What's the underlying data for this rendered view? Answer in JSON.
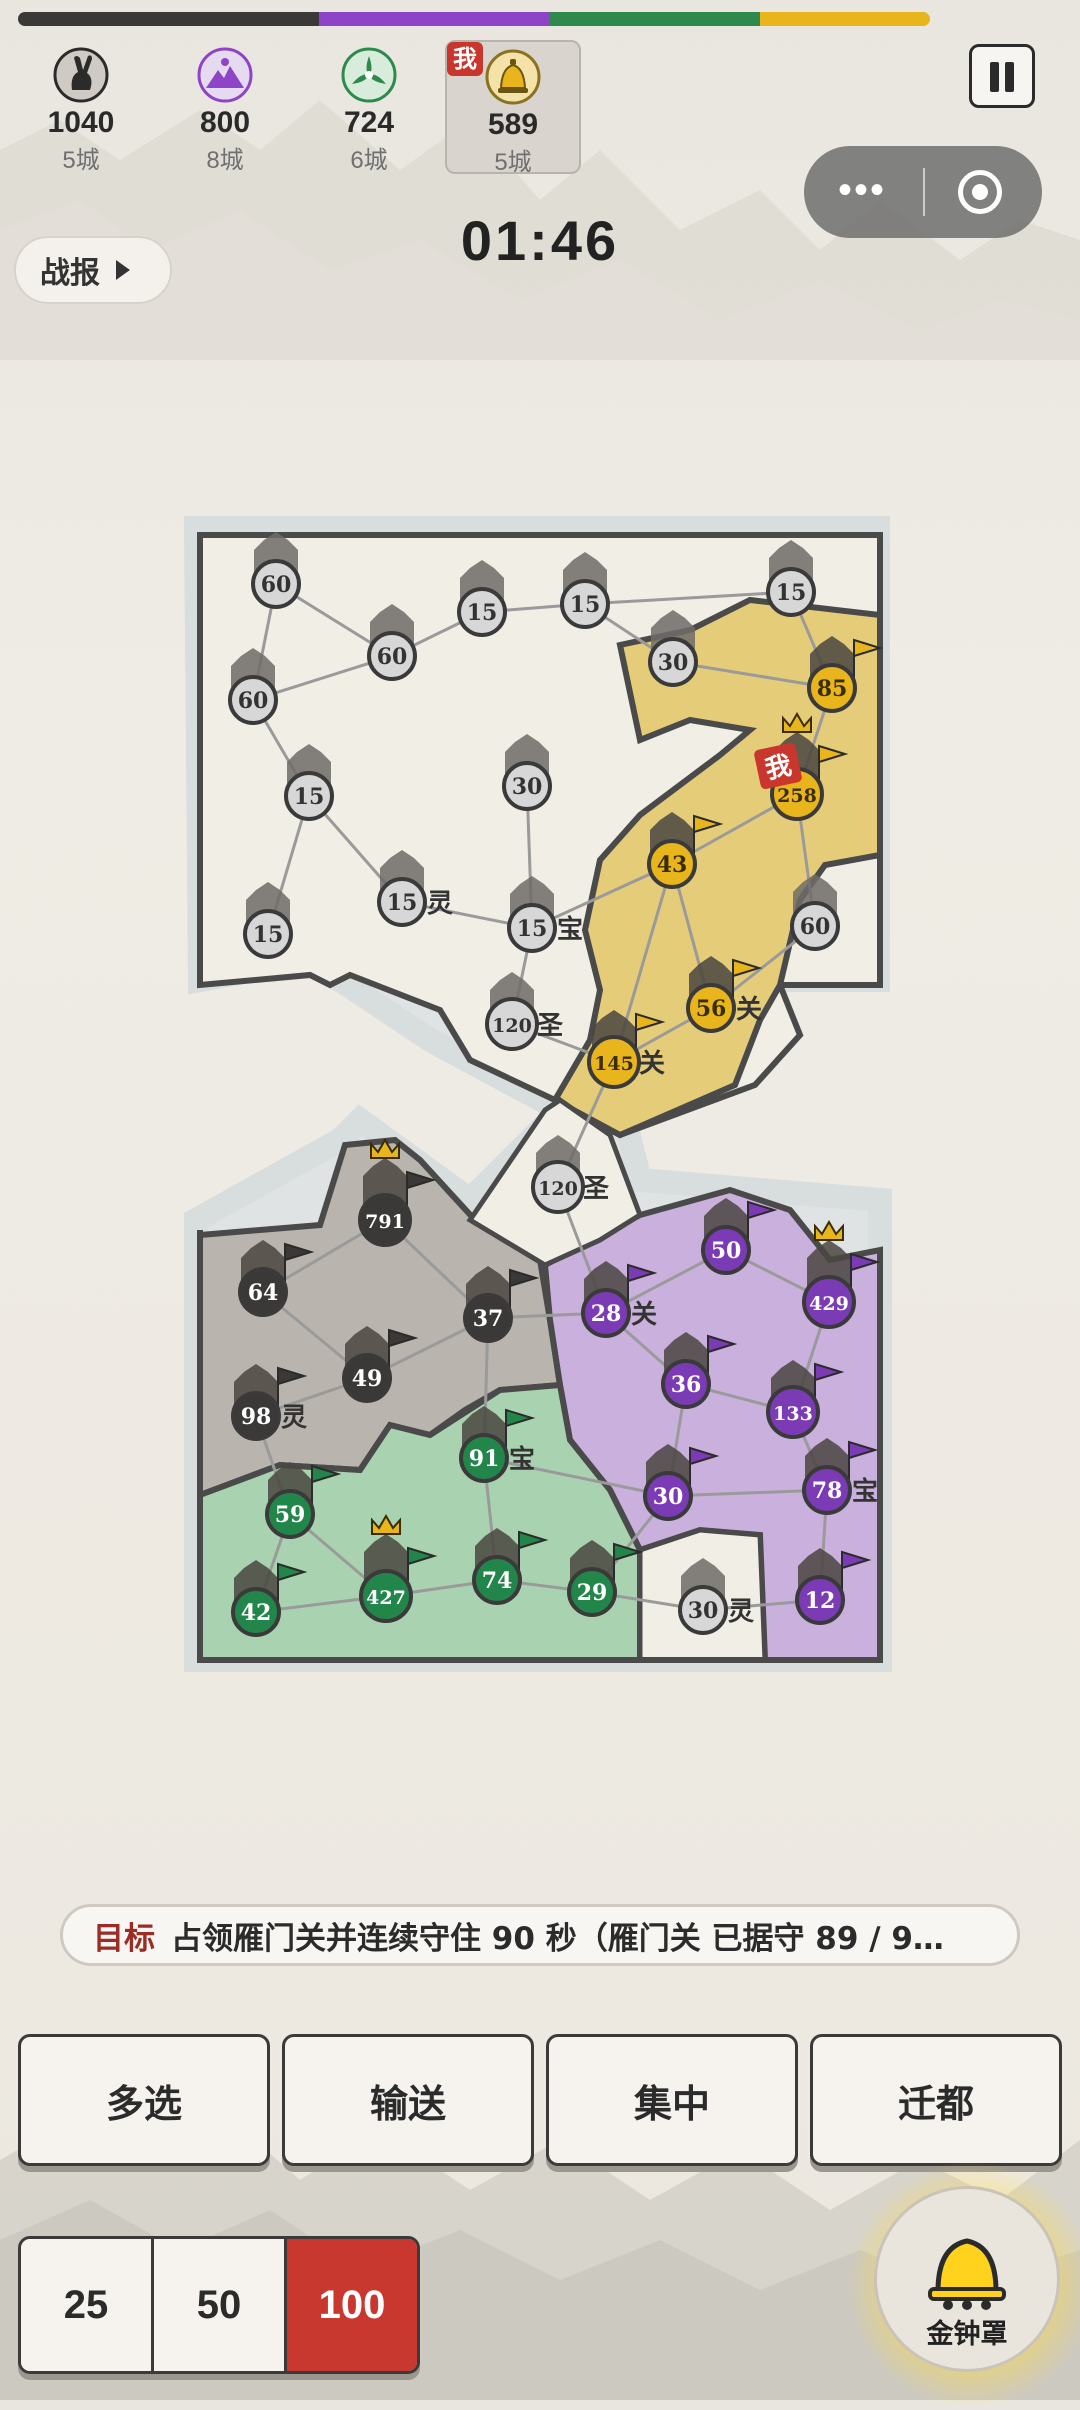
{
  "colors": {
    "dark": "#3a3938",
    "purple": "#8e44c6",
    "green": "#2e8a4c",
    "yellow": "#e8b51c",
    "neutral": "#cfcfcf",
    "gray_region": "#b9b4ad",
    "purple_region": "#c9b0dd",
    "green_region": "#a9d3b0",
    "yellow_region": "#e5cc79",
    "neutral_region": "#f1eee6"
  },
  "power_bar": [
    {
      "faction": "dark",
      "share": 1040
    },
    {
      "faction": "purple",
      "share": 800
    },
    {
      "faction": "green",
      "share": 724
    },
    {
      "faction": "yellow",
      "share": 589
    }
  ],
  "players": [
    {
      "score": "1040",
      "cities": "5城",
      "icon": "rabbit-icon",
      "faction": "dark"
    },
    {
      "score": "800",
      "cities": "8城",
      "icon": "mountain-icon",
      "faction": "purple"
    },
    {
      "score": "724",
      "cities": "6城",
      "icon": "shuriken-icon",
      "faction": "green"
    },
    {
      "score": "589",
      "cities": "5城",
      "icon": "bell-icon",
      "faction": "yellow",
      "me": true,
      "badge": "我"
    }
  ],
  "timer": "01:46",
  "report_button": "战报",
  "capsule": {
    "more": "•••"
  },
  "cities": [
    {
      "id": "c1",
      "value": "60",
      "owner": "neutral"
    },
    {
      "id": "c2",
      "value": "60",
      "owner": "neutral"
    },
    {
      "id": "c3",
      "value": "60",
      "owner": "neutral"
    },
    {
      "id": "c4",
      "value": "15",
      "owner": "neutral"
    },
    {
      "id": "c5",
      "value": "15",
      "owner": "neutral"
    },
    {
      "id": "c6",
      "value": "30",
      "owner": "neutral"
    },
    {
      "id": "c7",
      "value": "15",
      "owner": "neutral"
    },
    {
      "id": "c8",
      "value": "85",
      "owner": "yellow"
    },
    {
      "id": "c9",
      "value": "15",
      "owner": "neutral"
    },
    {
      "id": "c10",
      "value": "30",
      "owner": "neutral"
    },
    {
      "id": "c11",
      "value": "258",
      "owner": "yellow",
      "capital": true,
      "me": true
    },
    {
      "id": "c12",
      "value": "43",
      "owner": "yellow"
    },
    {
      "id": "c13",
      "value": "15",
      "owner": "neutral",
      "tag": "灵"
    },
    {
      "id": "c14",
      "value": "15",
      "owner": "neutral",
      "tag": "宝"
    },
    {
      "id": "c15",
      "value": "15",
      "owner": "neutral"
    },
    {
      "id": "c16",
      "value": "60",
      "owner": "neutral"
    },
    {
      "id": "c17",
      "value": "56",
      "owner": "yellow",
      "tag": "关"
    },
    {
      "id": "c18",
      "value": "120",
      "owner": "neutral",
      "tag": "圣"
    },
    {
      "id": "c19",
      "value": "145",
      "owner": "yellow",
      "tag": "关"
    },
    {
      "id": "c20",
      "value": "120",
      "owner": "neutral",
      "tag": "圣"
    },
    {
      "id": "c21",
      "value": "791",
      "owner": "dark",
      "capital": true
    },
    {
      "id": "c22",
      "value": "64",
      "owner": "dark"
    },
    {
      "id": "c23",
      "value": "37",
      "owner": "dark"
    },
    {
      "id": "c24",
      "value": "49",
      "owner": "dark"
    },
    {
      "id": "c25",
      "value": "98",
      "owner": "dark",
      "tag": "灵"
    },
    {
      "id": "c26",
      "value": "50",
      "owner": "purple"
    },
    {
      "id": "c27",
      "value": "429",
      "owner": "purple",
      "capital": true
    },
    {
      "id": "c28",
      "value": "28",
      "owner": "purple",
      "tag": "关"
    },
    {
      "id": "c29",
      "value": "36",
      "owner": "purple"
    },
    {
      "id": "c30",
      "value": "133",
      "owner": "purple"
    },
    {
      "id": "c31",
      "value": "91",
      "owner": "green",
      "tag": "宝"
    },
    {
      "id": "c32",
      "value": "30",
      "owner": "purple"
    },
    {
      "id": "c33",
      "value": "78",
      "owner": "purple",
      "tag": "宝"
    },
    {
      "id": "c34",
      "value": "59",
      "owner": "green"
    },
    {
      "id": "c35",
      "value": "42",
      "owner": "green"
    },
    {
      "id": "c36",
      "value": "427",
      "owner": "green",
      "capital": true
    },
    {
      "id": "c37",
      "value": "74",
      "owner": "green"
    },
    {
      "id": "c38",
      "value": "29",
      "owner": "green"
    },
    {
      "id": "c39",
      "value": "30",
      "owner": "neutral",
      "tag": "灵"
    },
    {
      "id": "c40",
      "value": "12",
      "owner": "purple"
    }
  ],
  "me_marker": "我",
  "objective": {
    "label": "目标",
    "text": "占领雁门关并连续守住 90 秒（雁门关 已据守 89 / 9…"
  },
  "actions": [
    "多选",
    "输送",
    "集中",
    "迁都"
  ],
  "percents": [
    "25",
    "50",
    "100"
  ],
  "bell_button": "金钟罩"
}
